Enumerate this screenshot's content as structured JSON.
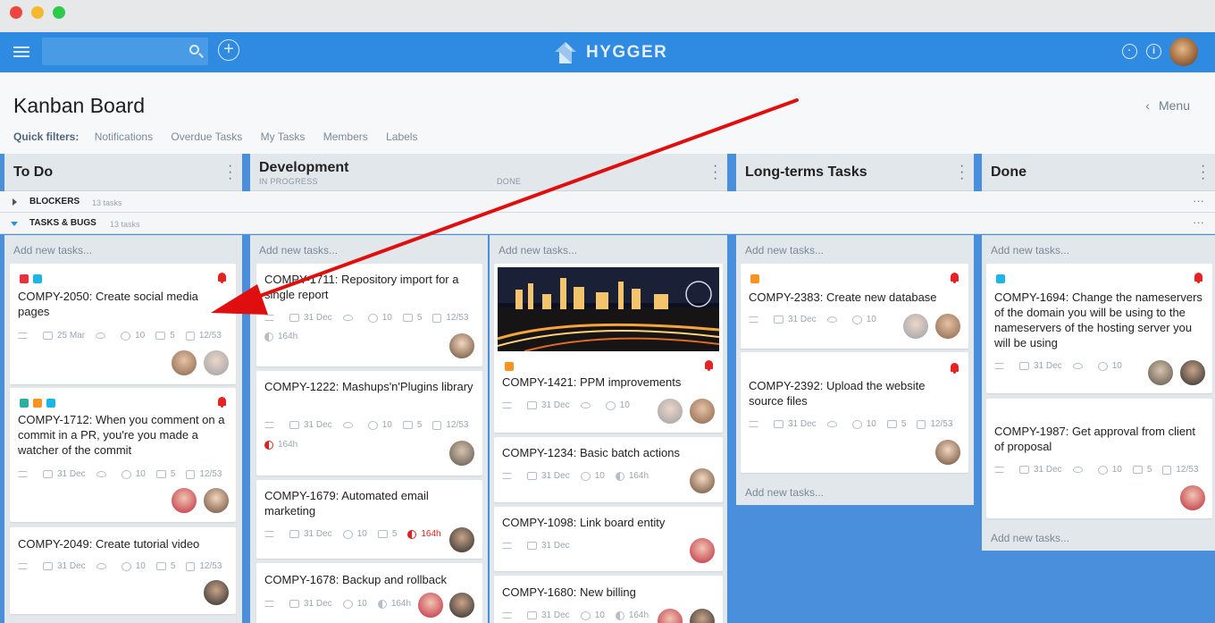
{
  "app": {
    "logo_text": "HYGGER"
  },
  "colors": {
    "topbar": "#2f8ae1",
    "board_bg": "#4a8fdc",
    "column_bg": "#e2e7eb",
    "alert_red": "#e62222",
    "arrow_red": "#e00f0f"
  },
  "icons": {
    "menu": "hamburger-icon",
    "search": "search-icon",
    "add": "plus-circle-icon",
    "clock": "clock-icon",
    "info": "info-icon",
    "more": "kebab-icon"
  },
  "header": {
    "title": "Kanban Board",
    "menu_label": "Menu",
    "quick_filters_label": "Quick filters:",
    "filters": [
      "Notifications",
      "Overdue Tasks",
      "My Tasks",
      "Members",
      "Labels"
    ]
  },
  "columns": [
    {
      "name": "To Do"
    },
    {
      "name": "Development",
      "sub_left": "IN PROGRESS",
      "sub_right": "DONE"
    },
    {
      "name": "Long-terms Tasks"
    },
    {
      "name": "Done"
    }
  ],
  "swimlanes": [
    {
      "name": "BLOCKERS",
      "count": "13 tasks",
      "expanded": false
    },
    {
      "name": "TASKS & BUGS",
      "count": "13 tasks",
      "expanded": true
    }
  ],
  "add_task_label": "Add new tasks...",
  "lanes": {
    "todo": [
      {
        "title": "COMPY-2050: Create social media pages",
        "labels": [
          "#e8303a",
          "#1ab6e6"
        ],
        "alert": true,
        "date": "25 Mar",
        "comments": "10",
        "attachments": "5",
        "checklist": "12/53"
      },
      {
        "title": "COMPY-1712: When you comment on a commit in a PR, you're you made a watcher of the commit",
        "labels": [
          "#2ab09c",
          "#f7931e",
          "#1ab6e6"
        ],
        "alert": true,
        "date": "31 Dec",
        "comments": "10",
        "attachments": "5",
        "checklist": "12/53"
      },
      {
        "title": "COMPY-2049: Create tutorial video",
        "date": "31 Dec",
        "comments": "10",
        "attachments": "5",
        "checklist": "12/53"
      }
    ],
    "inprogress": [
      {
        "title": "COMPY-1711: Repository import for a single report",
        "date": "31 Dec",
        "comments": "10",
        "attachments": "5",
        "checklist": "12/53",
        "time": "164h"
      },
      {
        "title": "COMPY-1222: Mashups'n'Plugins library",
        "date": "31 Dec",
        "comments": "10",
        "attachments": "5",
        "checklist": "12/53",
        "time": "164h",
        "time_overdue": true
      },
      {
        "title": "COMPY-1679: Automated email marketing",
        "date": "31 Dec",
        "comments": "10",
        "attachments": "5",
        "time": "164h",
        "time_overdue": true
      },
      {
        "title": "COMPY-1678: Backup and rollback",
        "date": "31 Dec",
        "comments": "10",
        "time": "164h"
      }
    ],
    "devdone": [
      {
        "title": "COMPY-1421: PPM improvements",
        "labels": [
          "#f7931e"
        ],
        "alert": true,
        "date": "31 Dec",
        "comments": "10",
        "has_image": true
      },
      {
        "title": "COMPY-1234: Basic batch actions",
        "date": "31 Dec",
        "comments": "10",
        "time": "164h"
      },
      {
        "title": "COMPY-1098: Link board entity",
        "date": "31 Dec"
      },
      {
        "title": "COMPY-1680: New billing",
        "date": "31 Dec",
        "comments": "10",
        "time": "164h"
      }
    ],
    "longterm": [
      {
        "title": "COMPY-2383: Create new database",
        "labels": [
          "#f7931e"
        ],
        "alert": true,
        "date": "31 Dec",
        "comments": "10"
      },
      {
        "title": "COMPY-2392: Upload the website source files",
        "alert": true,
        "date": "31 Dec",
        "comments": "10",
        "attachments": "5",
        "checklist": "12/53"
      }
    ],
    "done": [
      {
        "title": "COMPY-1694: Change the nameservers of the domain you will be using to the nameservers of the hosting server you will be using",
        "labels": [
          "#1ab6e6"
        ],
        "alert": true,
        "date": "31 Dec",
        "comments": "10"
      },
      {
        "title": "COMPY-1987: Get approval from client of proposal",
        "date": "31 Dec",
        "comments": "10",
        "attachments": "5",
        "checklist": "12/53"
      }
    ]
  }
}
